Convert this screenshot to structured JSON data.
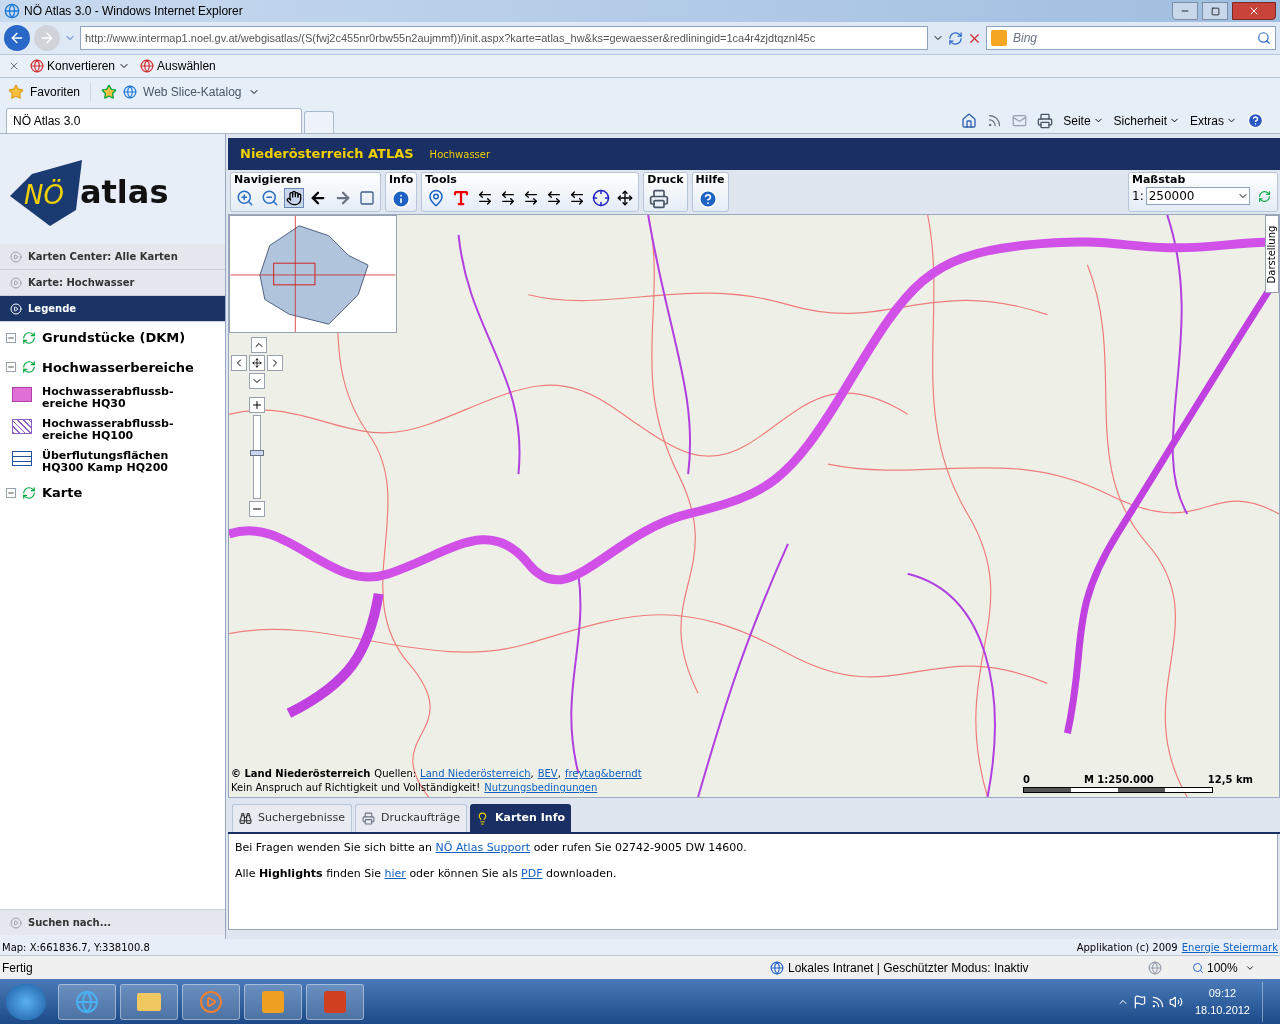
{
  "window": {
    "title": "NÖ Atlas 3.0 - Windows Internet Explorer"
  },
  "address_bar": {
    "url": "http://www.intermap1.noel.gv.at/webgisatlas/(S(fwj2c455nr0rbw55n2aujmmf))/init.aspx?karte=atlas_hw&ks=gewaesser&redliningid=1ca4r4zjdtqznl45c",
    "search_placeholder": "Bing"
  },
  "command_bar": [
    "Konvertieren",
    "Auswählen"
  ],
  "favorites_bar": {
    "favorites": "Favoriten",
    "slice": "Web Slice-Katalog"
  },
  "browser_tabs": [
    {
      "label": "NÖ Atlas 3.0",
      "selected": true
    }
  ],
  "browser_commands": [
    "Seite",
    "Sicherheit",
    "Extras"
  ],
  "logo": {
    "prefix": "NÖ",
    "name": "atlas"
  },
  "sidebar": {
    "accordion": [
      {
        "label": "Karten Center: Alle Karten",
        "selected": false
      },
      {
        "label": "Karte: Hochwasser",
        "selected": false
      },
      {
        "label": "Legende",
        "selected": true
      }
    ],
    "legend": [
      {
        "kind": "layer",
        "label": "Grundstücke (DKM)",
        "expanded": true
      },
      {
        "kind": "layer",
        "label": "Hochwasserbereiche",
        "expanded": true
      },
      {
        "kind": "fill",
        "label": "Hochwasserabflussb-ereiche HQ30"
      },
      {
        "kind": "hatch",
        "label": "Hochwasserabflussb-ereiche HQ100"
      },
      {
        "kind": "outline",
        "label": "Überflutungsflächen HQ300 Kamp HQ200"
      },
      {
        "kind": "layer",
        "label": "Karte",
        "expanded": true
      }
    ],
    "footer": "Suchen nach..."
  },
  "header": {
    "title": "Niederösterreich ATLAS",
    "subtitle": "Hochwasser"
  },
  "toolbar": [
    {
      "kind": "navigate",
      "label": "Navigieren"
    },
    {
      "kind": "info",
      "label": "Info"
    },
    {
      "kind": "tools",
      "label": "Tools"
    },
    {
      "kind": "print",
      "label": "Druck"
    },
    {
      "kind": "help",
      "label": "Hilfe"
    }
  ],
  "scale": {
    "label": "Maßstab",
    "prefix": "1:",
    "value": "250000"
  },
  "map": {
    "side_tab": "Darstellung",
    "zoom": {
      "level": 0.55
    },
    "attribution": {
      "owner": "© Land Niederösterreich",
      "sources_label": "Quellen:",
      "sources": [
        "Land Niederösterreich",
        "BEV",
        "freytag&berndt"
      ],
      "separator": ",",
      "disclaimer": "Kein Anspruch auf Richtigkeit und Vollständigkeit!",
      "terms": "Nutzungsbedingungen"
    },
    "scale_bar": {
      "start": "0",
      "label": "M 1:250.000",
      "end": "12,5 km"
    }
  },
  "panel_tabs": [
    {
      "kind": "search",
      "label": "Suchergebnisse",
      "selected": false
    },
    {
      "kind": "print",
      "label": "Druckaufträge",
      "selected": false
    },
    {
      "kind": "info",
      "label": "Karten Info",
      "selected": true
    }
  ],
  "panel_text": [
    [
      {
        "kind": "text",
        "text": "Bei Fragen wenden Sie sich bitte an"
      },
      {
        "kind": "link",
        "text": "NÖ Atlas Support"
      },
      {
        "kind": "text",
        "text": "oder rufen Sie 02742-9005 DW 14600."
      }
    ],
    [
      {
        "kind": "text",
        "text": "Alle **Highlights** finden Sie"
      },
      {
        "kind": "link",
        "text": "hier"
      },
      {
        "kind": "text",
        "text": "oder können Sie als"
      },
      {
        "kind": "link",
        "text": "PDF"
      },
      {
        "kind": "text",
        "text": "downloaden."
      }
    ]
  ],
  "app_status": {
    "coords": "Map: X:661836.7, Y:338100.8",
    "credit": "Applikation (c) 2009",
    "credit_link": "Energie Steiermark"
  },
  "ie_status": {
    "text": "Fertig",
    "zone": "Lokales Intranet | Geschützter Modus: Inaktiv",
    "zoom": "100%"
  },
  "taskbar": {
    "time": "09:12",
    "date": "18.10.2012"
  }
}
